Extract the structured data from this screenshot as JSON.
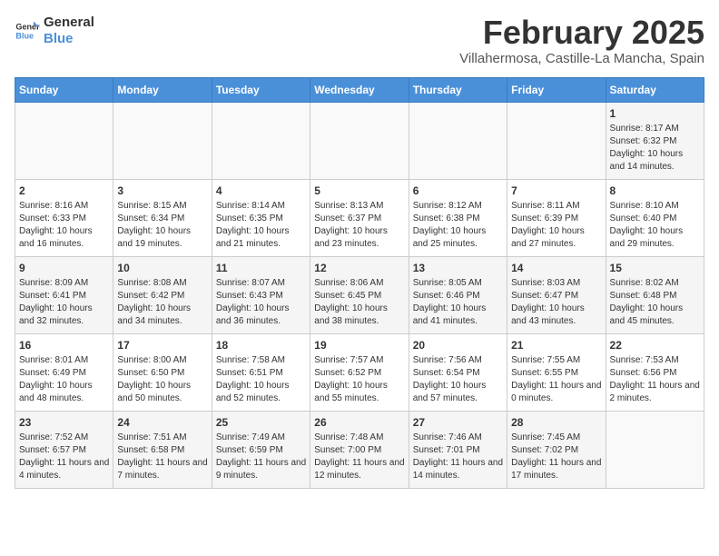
{
  "logo": {
    "line1": "General",
    "line2": "Blue"
  },
  "title": "February 2025",
  "subtitle": "Villahermosa, Castille-La Mancha, Spain",
  "days_of_week": [
    "Sunday",
    "Monday",
    "Tuesday",
    "Wednesday",
    "Thursday",
    "Friday",
    "Saturday"
  ],
  "weeks": [
    [
      {
        "day": "",
        "info": ""
      },
      {
        "day": "",
        "info": ""
      },
      {
        "day": "",
        "info": ""
      },
      {
        "day": "",
        "info": ""
      },
      {
        "day": "",
        "info": ""
      },
      {
        "day": "",
        "info": ""
      },
      {
        "day": "1",
        "info": "Sunrise: 8:17 AM\nSunset: 6:32 PM\nDaylight: 10 hours and 14 minutes."
      }
    ],
    [
      {
        "day": "2",
        "info": "Sunrise: 8:16 AM\nSunset: 6:33 PM\nDaylight: 10 hours and 16 minutes."
      },
      {
        "day": "3",
        "info": "Sunrise: 8:15 AM\nSunset: 6:34 PM\nDaylight: 10 hours and 19 minutes."
      },
      {
        "day": "4",
        "info": "Sunrise: 8:14 AM\nSunset: 6:35 PM\nDaylight: 10 hours and 21 minutes."
      },
      {
        "day": "5",
        "info": "Sunrise: 8:13 AM\nSunset: 6:37 PM\nDaylight: 10 hours and 23 minutes."
      },
      {
        "day": "6",
        "info": "Sunrise: 8:12 AM\nSunset: 6:38 PM\nDaylight: 10 hours and 25 minutes."
      },
      {
        "day": "7",
        "info": "Sunrise: 8:11 AM\nSunset: 6:39 PM\nDaylight: 10 hours and 27 minutes."
      },
      {
        "day": "8",
        "info": "Sunrise: 8:10 AM\nSunset: 6:40 PM\nDaylight: 10 hours and 29 minutes."
      }
    ],
    [
      {
        "day": "9",
        "info": "Sunrise: 8:09 AM\nSunset: 6:41 PM\nDaylight: 10 hours and 32 minutes."
      },
      {
        "day": "10",
        "info": "Sunrise: 8:08 AM\nSunset: 6:42 PM\nDaylight: 10 hours and 34 minutes."
      },
      {
        "day": "11",
        "info": "Sunrise: 8:07 AM\nSunset: 6:43 PM\nDaylight: 10 hours and 36 minutes."
      },
      {
        "day": "12",
        "info": "Sunrise: 8:06 AM\nSunset: 6:45 PM\nDaylight: 10 hours and 38 minutes."
      },
      {
        "day": "13",
        "info": "Sunrise: 8:05 AM\nSunset: 6:46 PM\nDaylight: 10 hours and 41 minutes."
      },
      {
        "day": "14",
        "info": "Sunrise: 8:03 AM\nSunset: 6:47 PM\nDaylight: 10 hours and 43 minutes."
      },
      {
        "day": "15",
        "info": "Sunrise: 8:02 AM\nSunset: 6:48 PM\nDaylight: 10 hours and 45 minutes."
      }
    ],
    [
      {
        "day": "16",
        "info": "Sunrise: 8:01 AM\nSunset: 6:49 PM\nDaylight: 10 hours and 48 minutes."
      },
      {
        "day": "17",
        "info": "Sunrise: 8:00 AM\nSunset: 6:50 PM\nDaylight: 10 hours and 50 minutes."
      },
      {
        "day": "18",
        "info": "Sunrise: 7:58 AM\nSunset: 6:51 PM\nDaylight: 10 hours and 52 minutes."
      },
      {
        "day": "19",
        "info": "Sunrise: 7:57 AM\nSunset: 6:52 PM\nDaylight: 10 hours and 55 minutes."
      },
      {
        "day": "20",
        "info": "Sunrise: 7:56 AM\nSunset: 6:54 PM\nDaylight: 10 hours and 57 minutes."
      },
      {
        "day": "21",
        "info": "Sunrise: 7:55 AM\nSunset: 6:55 PM\nDaylight: 11 hours and 0 minutes."
      },
      {
        "day": "22",
        "info": "Sunrise: 7:53 AM\nSunset: 6:56 PM\nDaylight: 11 hours and 2 minutes."
      }
    ],
    [
      {
        "day": "23",
        "info": "Sunrise: 7:52 AM\nSunset: 6:57 PM\nDaylight: 11 hours and 4 minutes."
      },
      {
        "day": "24",
        "info": "Sunrise: 7:51 AM\nSunset: 6:58 PM\nDaylight: 11 hours and 7 minutes."
      },
      {
        "day": "25",
        "info": "Sunrise: 7:49 AM\nSunset: 6:59 PM\nDaylight: 11 hours and 9 minutes."
      },
      {
        "day": "26",
        "info": "Sunrise: 7:48 AM\nSunset: 7:00 PM\nDaylight: 11 hours and 12 minutes."
      },
      {
        "day": "27",
        "info": "Sunrise: 7:46 AM\nSunset: 7:01 PM\nDaylight: 11 hours and 14 minutes."
      },
      {
        "day": "28",
        "info": "Sunrise: 7:45 AM\nSunset: 7:02 PM\nDaylight: 11 hours and 17 minutes."
      },
      {
        "day": "",
        "info": ""
      }
    ]
  ]
}
